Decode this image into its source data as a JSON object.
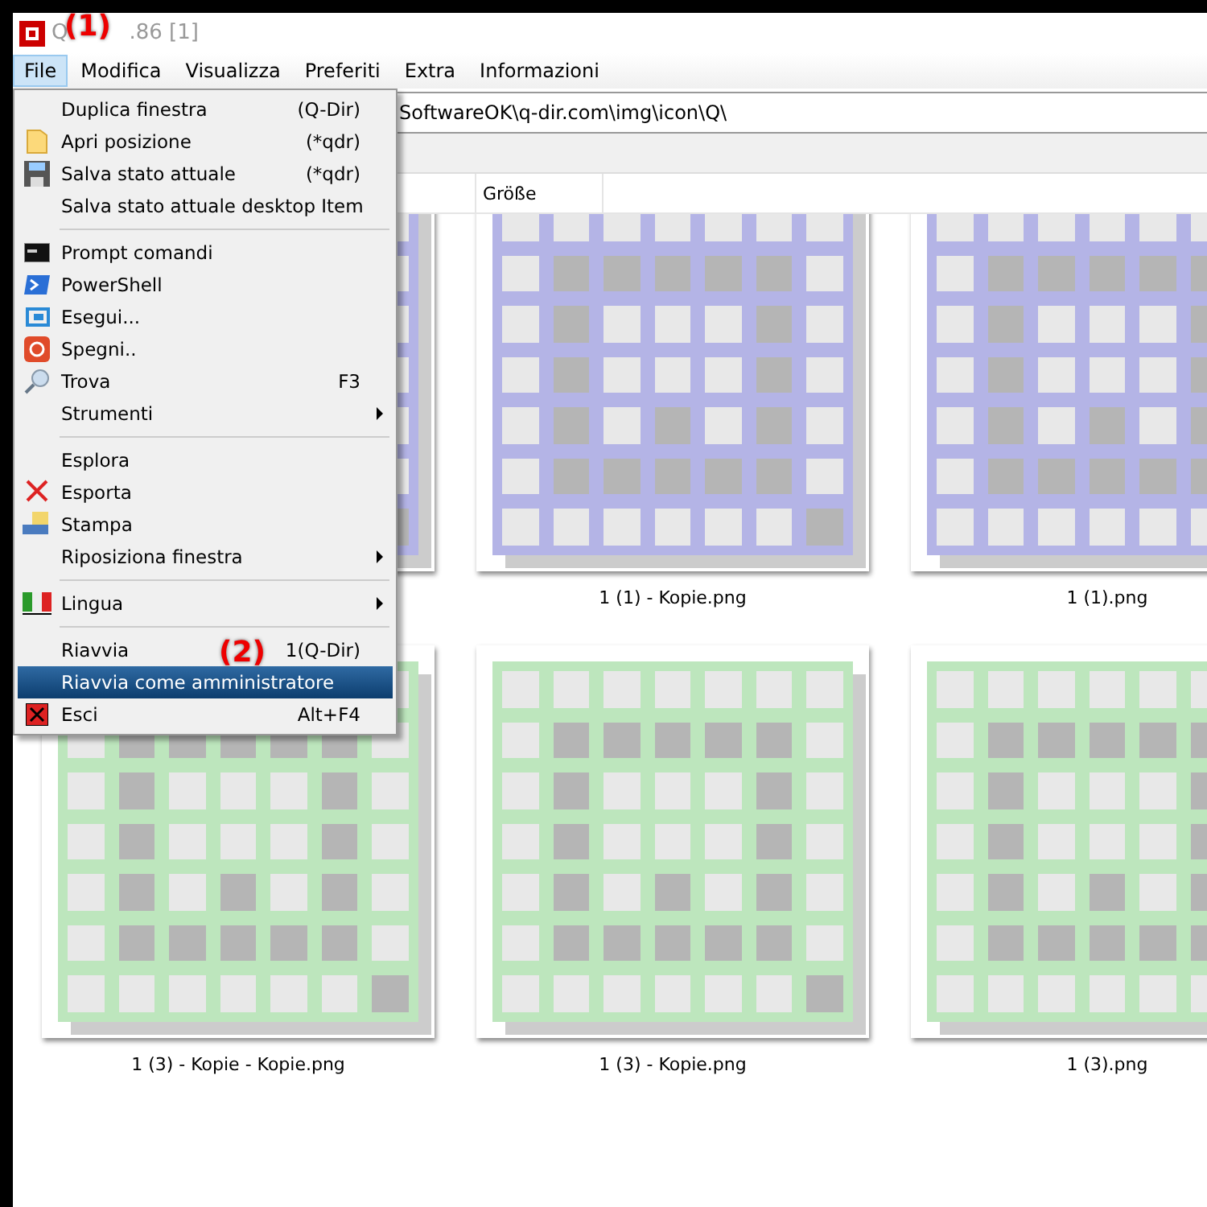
{
  "window": {
    "title_start": "Q",
    "title_end": ".86 [1]"
  },
  "menubar": [
    {
      "label": "File",
      "selected": true
    },
    {
      "label": "Modifica",
      "selected": false
    },
    {
      "label": "Visualizza",
      "selected": false
    },
    {
      "label": "Preferiti",
      "selected": false
    },
    {
      "label": "Extra",
      "selected": false
    },
    {
      "label": "Informazioni",
      "selected": false
    }
  ],
  "address": {
    "value": "SoftwareOK\\q-dir.com\\img\\icon\\Q\\"
  },
  "columns": [
    "Größe"
  ],
  "files": [
    {
      "color": "#b4b4e6"
    },
    {
      "name": "1 (1) - Kopie.png",
      "color": "#b4b4e6"
    },
    {
      "name": "1 (1).png",
      "color": "#b4b4e6"
    },
    {
      "name": "1 (3) - Kopie - Kopie.png",
      "color": "#bde6bd"
    },
    {
      "name": "1 (3) - Kopie.png",
      "color": "#bde6bd"
    },
    {
      "name": "1 (3).png",
      "color": "#bde6bd"
    }
  ],
  "menu": [
    {
      "kind": "item",
      "label": "Duplica finestra",
      "shortcut": "(Q-Dir)",
      "submenu": false,
      "selected": false
    },
    {
      "kind": "item",
      "label": "Apri posizione",
      "shortcut": "(*qdr)",
      "submenu": false,
      "selected": false
    },
    {
      "kind": "item",
      "label": "Salva stato attuale",
      "shortcut": "(*qdr)",
      "submenu": false,
      "selected": false
    },
    {
      "kind": "item",
      "label": "Salva stato attuale desktop Item",
      "submenu": false,
      "selected": false
    },
    {
      "kind": "separator"
    },
    {
      "kind": "item",
      "label": "Prompt comandi",
      "submenu": false,
      "selected": false
    },
    {
      "kind": "item",
      "label": "PowerShell",
      "submenu": false,
      "selected": false
    },
    {
      "kind": "item",
      "label": "Esegui...",
      "submenu": false,
      "selected": false
    },
    {
      "kind": "item",
      "label": "Spegni..",
      "submenu": false,
      "selected": false
    },
    {
      "kind": "item",
      "label": "Trova",
      "shortcut": "F3",
      "submenu": false,
      "selected": false
    },
    {
      "kind": "item",
      "label": "Strumenti",
      "submenu": true,
      "selected": false
    },
    {
      "kind": "separator"
    },
    {
      "kind": "item",
      "label": "Esplora",
      "submenu": false,
      "selected": false
    },
    {
      "kind": "item",
      "label": "Esporta",
      "submenu": false,
      "selected": false
    },
    {
      "kind": "item",
      "label": "Stampa",
      "submenu": false,
      "selected": false
    },
    {
      "kind": "item",
      "label": "Riposiziona finestra",
      "submenu": true,
      "selected": false
    },
    {
      "kind": "separator"
    },
    {
      "kind": "item",
      "label": "Lingua",
      "submenu": true,
      "selected": false
    },
    {
      "kind": "separator"
    },
    {
      "kind": "item",
      "label": "Riavvia",
      "shortcut": "1(Q-Dir)",
      "submenu": false,
      "selected": false
    },
    {
      "kind": "item",
      "label": "Riavvia come amministratore",
      "submenu": false,
      "selected": true
    },
    {
      "kind": "item",
      "label": "Esci",
      "shortcut": "Alt+F4",
      "submenu": false,
      "selected": false
    }
  ],
  "annotations": [
    {
      "label": "(1)"
    },
    {
      "label": "(2)"
    }
  ]
}
